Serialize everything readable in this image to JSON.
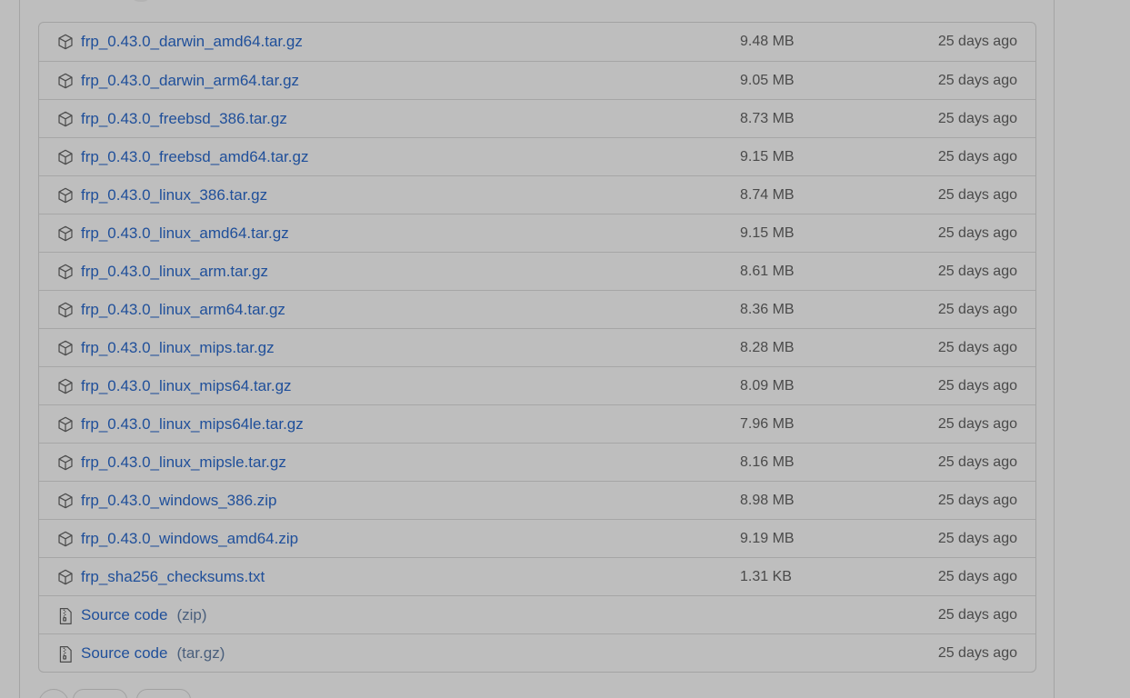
{
  "assets": [
    {
      "name": "frp_0.43.0_darwin_amd64.tar.gz",
      "size": "9.48 MB",
      "date": "25 days ago",
      "icon": "package-icon"
    },
    {
      "name": "frp_0.43.0_darwin_arm64.tar.gz",
      "size": "9.05 MB",
      "date": "25 days ago",
      "icon": "package-icon"
    },
    {
      "name": "frp_0.43.0_freebsd_386.tar.gz",
      "size": "8.73 MB",
      "date": "25 days ago",
      "icon": "package-icon"
    },
    {
      "name": "frp_0.43.0_freebsd_amd64.tar.gz",
      "size": "9.15 MB",
      "date": "25 days ago",
      "icon": "package-icon"
    },
    {
      "name": "frp_0.43.0_linux_386.tar.gz",
      "size": "8.74 MB",
      "date": "25 days ago",
      "icon": "package-icon"
    },
    {
      "name": "frp_0.43.0_linux_amd64.tar.gz",
      "size": "9.15 MB",
      "date": "25 days ago",
      "icon": "package-icon"
    },
    {
      "name": "frp_0.43.0_linux_arm.tar.gz",
      "size": "8.61 MB",
      "date": "25 days ago",
      "icon": "package-icon"
    },
    {
      "name": "frp_0.43.0_linux_arm64.tar.gz",
      "size": "8.36 MB",
      "date": "25 days ago",
      "icon": "package-icon"
    },
    {
      "name": "frp_0.43.0_linux_mips.tar.gz",
      "size": "8.28 MB",
      "date": "25 days ago",
      "icon": "package-icon"
    },
    {
      "name": "frp_0.43.0_linux_mips64.tar.gz",
      "size": "8.09 MB",
      "date": "25 days ago",
      "icon": "package-icon"
    },
    {
      "name": "frp_0.43.0_linux_mips64le.tar.gz",
      "size": "7.96 MB",
      "date": "25 days ago",
      "icon": "package-icon"
    },
    {
      "name": "frp_0.43.0_linux_mipsle.tar.gz",
      "size": "8.16 MB",
      "date": "25 days ago",
      "icon": "package-icon"
    },
    {
      "name": "frp_0.43.0_windows_386.zip",
      "size": "8.98 MB",
      "date": "25 days ago",
      "icon": "package-icon"
    },
    {
      "name": "frp_0.43.0_windows_amd64.zip",
      "size": "9.19 MB",
      "date": "25 days ago",
      "icon": "package-icon"
    },
    {
      "name": "frp_sha256_checksums.txt",
      "size": "1.31 KB",
      "date": "25 days ago",
      "icon": "package-icon"
    }
  ],
  "source_code": [
    {
      "label": "Source code",
      "format": "(zip)",
      "date": "25 days ago",
      "icon": "file-zip-icon"
    },
    {
      "label": "Source code",
      "format": "(tar.gz)",
      "date": "25 days ago",
      "icon": "file-zip-icon"
    }
  ],
  "colors": {
    "background": "#bebebe",
    "link": "#1f4f9a",
    "muted_text": "#4a4a4a",
    "border": "#a6a6a6"
  }
}
